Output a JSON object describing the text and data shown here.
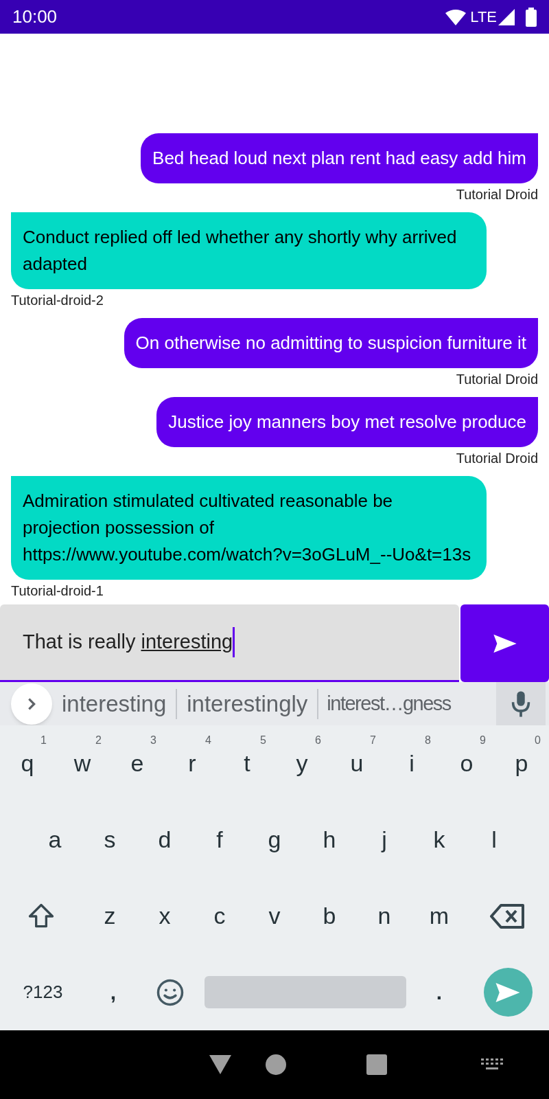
{
  "status_bar": {
    "time": "10:00",
    "network": "LTE"
  },
  "messages": [
    {
      "kind": "sent",
      "text": "Bed head loud next plan rent had easy add him",
      "sender": "Tutorial Droid"
    },
    {
      "kind": "received",
      "text": "Conduct replied off led whether any shortly why arrived adapted",
      "sender": "Tutorial-droid-2"
    },
    {
      "kind": "sent",
      "text": "On otherwise no admitting to suspicion furniture it",
      "sender": "Tutorial Droid"
    },
    {
      "kind": "sent",
      "text": "Justice joy manners boy met resolve produce",
      "sender": "Tutorial Droid"
    },
    {
      "kind": "received",
      "text": "Admiration stimulated cultivated reasonable be projection possession of https://www.youtube.com/watch?v=3oGLuM_--Uo&t=13s",
      "sender": "Tutorial-droid-1"
    }
  ],
  "composer": {
    "value": "That is really ",
    "composing": "interesting"
  },
  "suggestions": [
    "interesting",
    "interestingly",
    "interest…gness"
  ],
  "keyboard": {
    "rows": [
      {
        "keys": [
          {
            "kind": "letter",
            "label": "q",
            "hint": "1"
          },
          {
            "kind": "letter",
            "label": "w",
            "hint": "2"
          },
          {
            "kind": "letter",
            "label": "e",
            "hint": "3"
          },
          {
            "kind": "letter",
            "label": "r",
            "hint": "4"
          },
          {
            "kind": "letter",
            "label": "t",
            "hint": "5"
          },
          {
            "kind": "letter",
            "label": "y",
            "hint": "6"
          },
          {
            "kind": "letter",
            "label": "u",
            "hint": "7"
          },
          {
            "kind": "letter",
            "label": "i",
            "hint": "8"
          },
          {
            "kind": "letter",
            "label": "o",
            "hint": "9"
          },
          {
            "kind": "letter",
            "label": "p",
            "hint": "0"
          }
        ]
      },
      {
        "keys": [
          {
            "kind": "letter",
            "label": "a"
          },
          {
            "kind": "letter",
            "label": "s"
          },
          {
            "kind": "letter",
            "label": "d"
          },
          {
            "kind": "letter",
            "label": "f"
          },
          {
            "kind": "letter",
            "label": "g"
          },
          {
            "kind": "letter",
            "label": "h"
          },
          {
            "kind": "letter",
            "label": "j"
          },
          {
            "kind": "letter",
            "label": "k"
          },
          {
            "kind": "letter",
            "label": "l"
          }
        ]
      },
      {
        "keys": [
          {
            "kind": "shift"
          },
          {
            "kind": "letter",
            "label": "z"
          },
          {
            "kind": "letter",
            "label": "x"
          },
          {
            "kind": "letter",
            "label": "c"
          },
          {
            "kind": "letter",
            "label": "v"
          },
          {
            "kind": "letter",
            "label": "b"
          },
          {
            "kind": "letter",
            "label": "n"
          },
          {
            "kind": "letter",
            "label": "m"
          },
          {
            "kind": "backspace"
          }
        ]
      },
      {
        "keys": [
          {
            "kind": "symbols",
            "label": "?123"
          },
          {
            "kind": "char",
            "label": ","
          },
          {
            "kind": "emoji"
          },
          {
            "kind": "space"
          },
          {
            "kind": "char",
            "label": "."
          },
          {
            "kind": "enter"
          }
        ]
      }
    ]
  }
}
